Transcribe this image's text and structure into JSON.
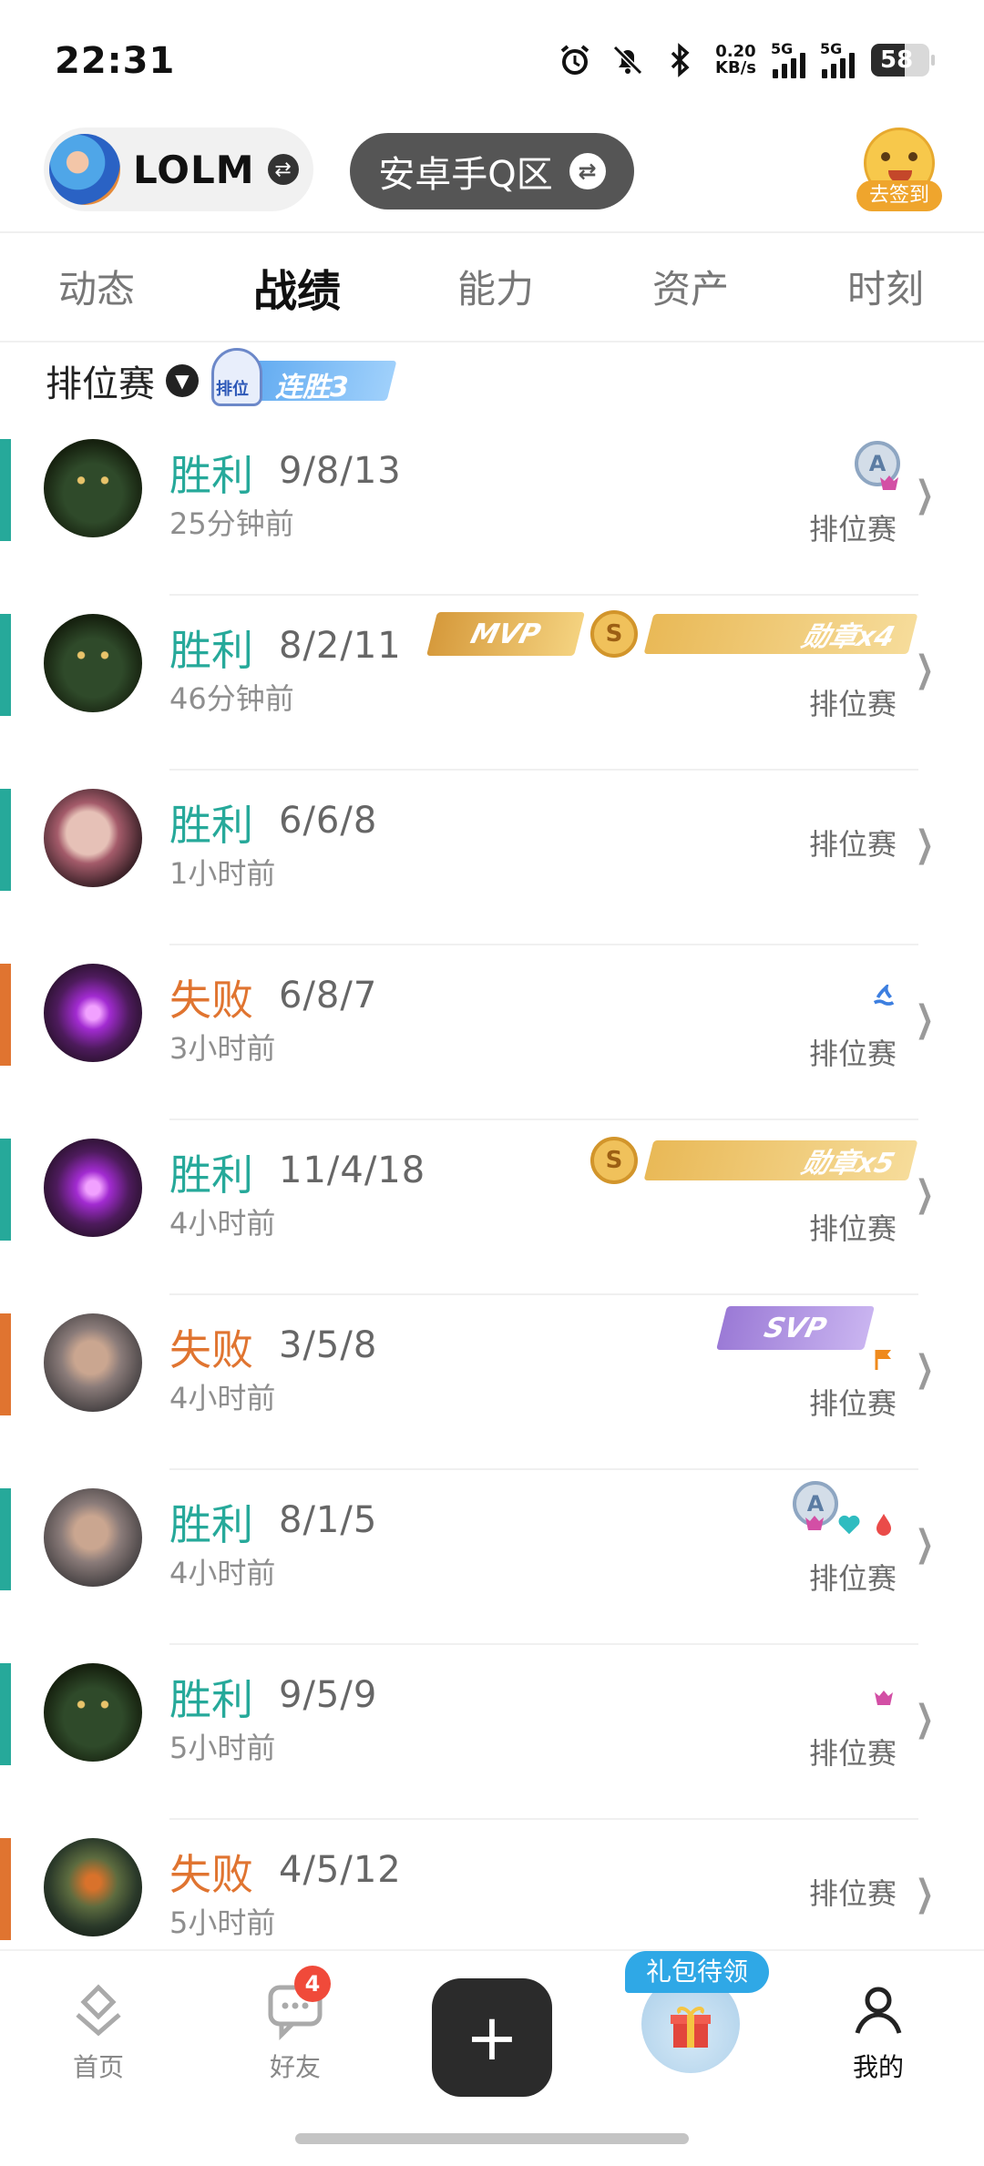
{
  "status_bar": {
    "time": "22:31",
    "net_speed_value": "0.20",
    "net_speed_unit": "KB/s",
    "signal_1": "5G",
    "signal_2": "5G",
    "battery": "58",
    "icons": [
      "alarm-icon",
      "mute-bell-icon",
      "bluetooth-icon"
    ]
  },
  "header": {
    "game_name": "LOLM",
    "server_name": "安卓手Q区",
    "checkin_label": "去签到"
  },
  "tabs": [
    {
      "label": "动态",
      "active": false
    },
    {
      "label": "战绩",
      "active": true
    },
    {
      "label": "能力",
      "active": false
    },
    {
      "label": "资产",
      "active": false
    },
    {
      "label": "时刻",
      "active": false
    }
  ],
  "filter": {
    "label": "排位赛",
    "streak_mascot_label": "排位",
    "streak_label": "连胜3"
  },
  "colors": {
    "win": "#26a99a",
    "loss": "#e07430"
  },
  "matches": [
    {
      "result": "胜利",
      "kda": "9/8/13",
      "time": "25分钟前",
      "mode": "排位赛",
      "avatar": "champion-wolf"
    },
    {
      "result": "胜利",
      "kda": "8/2/11",
      "time": "46分钟前",
      "mode": "排位赛",
      "avatar": "champion-wolf",
      "mvp": "MVP",
      "s_badge": "S",
      "medal": "勋章x4"
    },
    {
      "result": "胜利",
      "kda": "6/6/8",
      "time": "1小时前",
      "mode": "排位赛",
      "avatar": "champion-red-hair"
    },
    {
      "result": "失败",
      "kda": "6/8/7",
      "time": "3小时前",
      "mode": "排位赛",
      "avatar": "champion-purple"
    },
    {
      "result": "胜利",
      "kda": "11/4/18",
      "time": "4小时前",
      "mode": "排位赛",
      "avatar": "champion-purple",
      "s_badge": "S",
      "medal": "勋章x5"
    },
    {
      "result": "失败",
      "kda": "3/5/8",
      "time": "4小时前",
      "mode": "排位赛",
      "avatar": "champion-gray-hair",
      "svp": "SVP"
    },
    {
      "result": "胜利",
      "kda": "8/1/5",
      "time": "4小时前",
      "mode": "排位赛",
      "avatar": "champion-gray-hair"
    },
    {
      "result": "胜利",
      "kda": "9/5/9",
      "time": "5小时前",
      "mode": "排位赛",
      "avatar": "champion-wolf"
    },
    {
      "result": "失败",
      "kda": "4/5/12",
      "time": "5小时前",
      "mode": "排位赛",
      "avatar": "champion-green"
    }
  ],
  "badges": {
    "a_grade": "A"
  },
  "bottom_nav": {
    "home": "首页",
    "friends": "好友",
    "friends_badge": "4",
    "gift_tag": "礼包待领",
    "me": "我的"
  }
}
